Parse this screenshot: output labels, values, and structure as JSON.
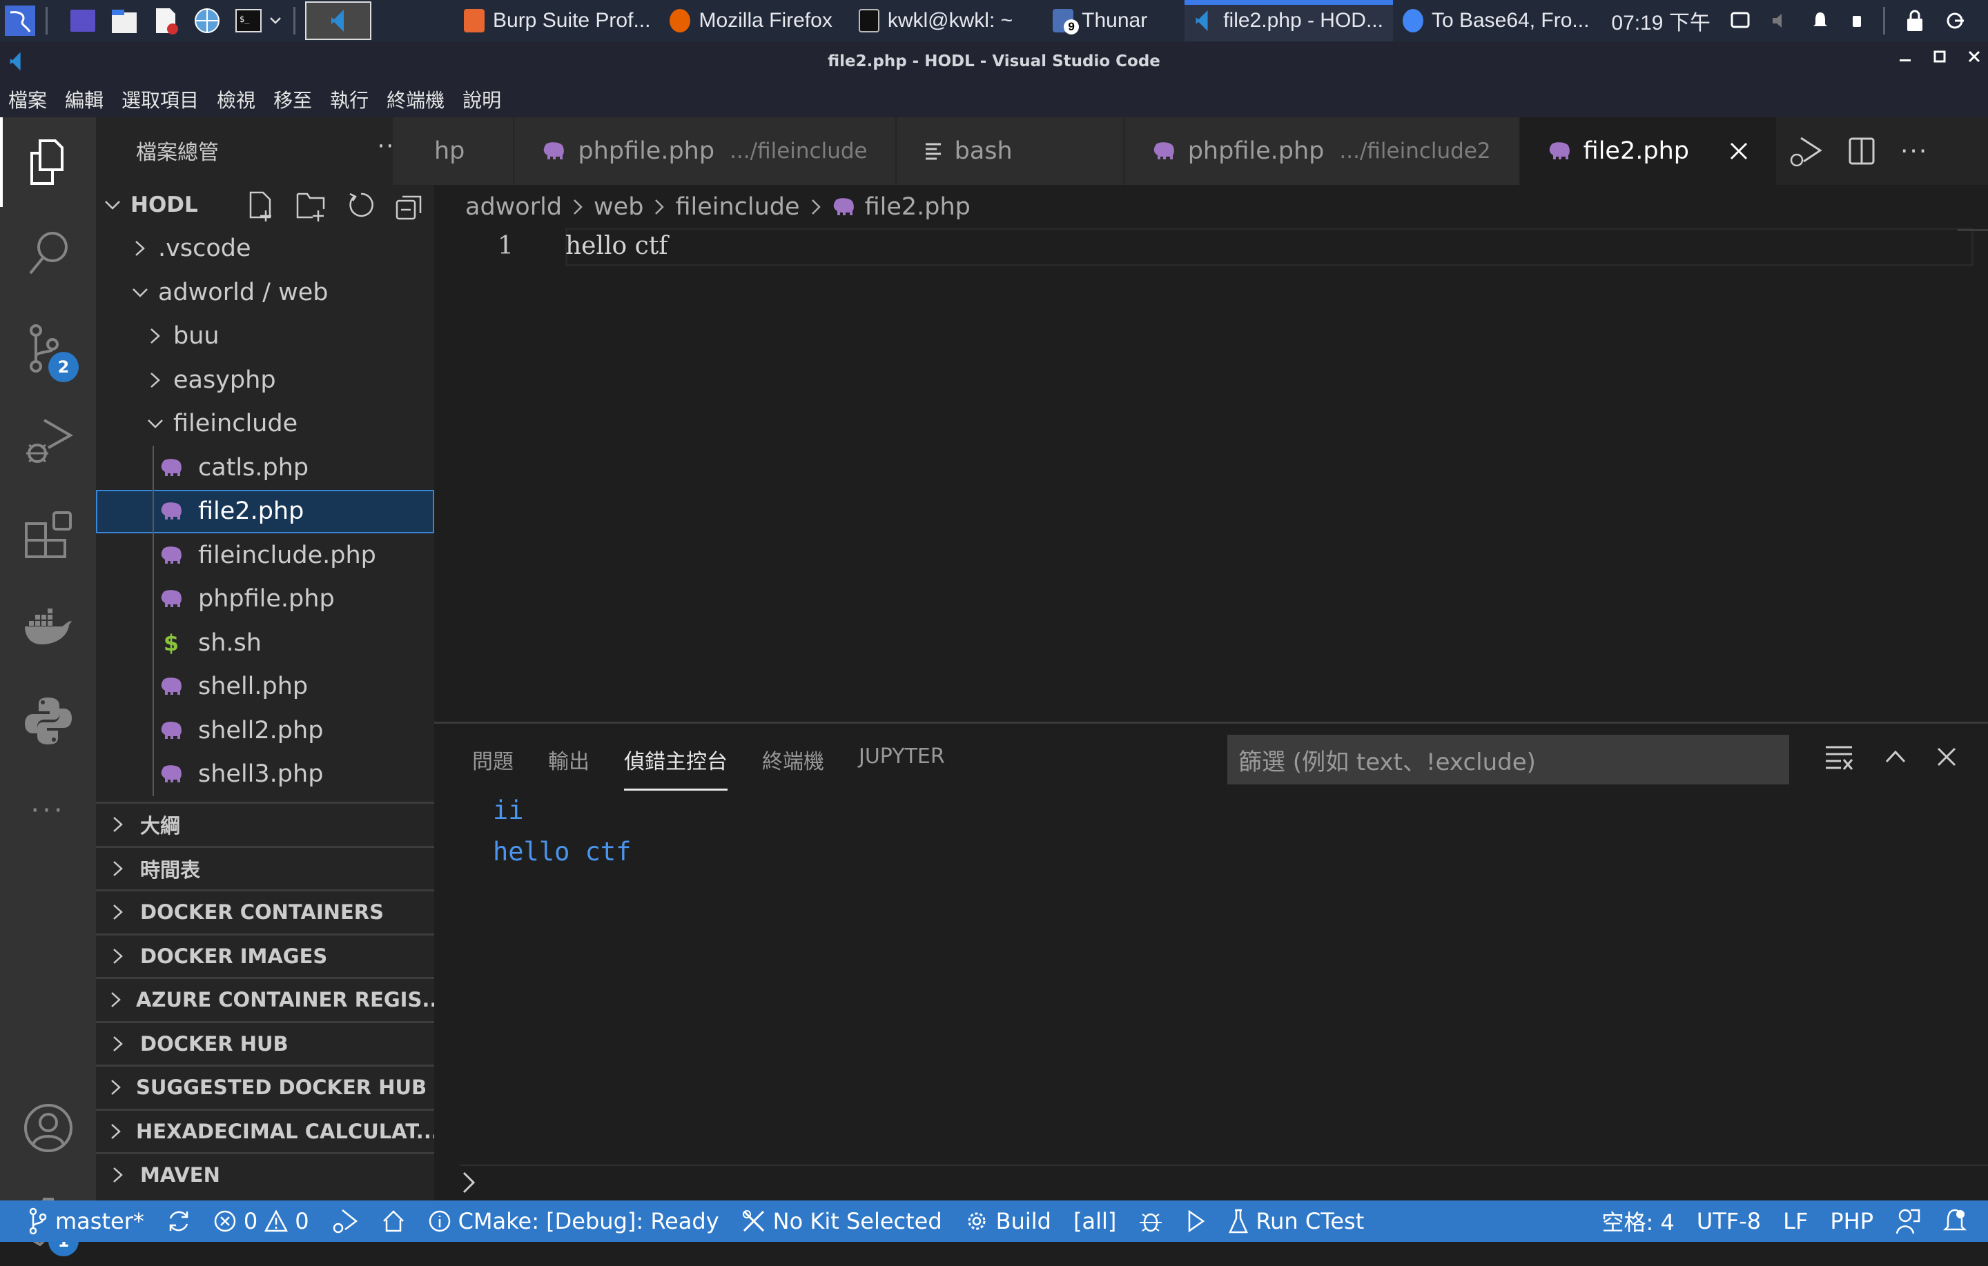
{
  "taskbar": {
    "apps": [
      {
        "label": "Burp Suite Prof...",
        "icon": "burp-icon",
        "color": "#e8662f"
      },
      {
        "label": "Mozilla Firefox",
        "icon": "firefox-icon",
        "color": "#e66000"
      },
      {
        "label": "kwkl@kwkl: ~",
        "icon": "terminal-icon",
        "color": "#111111"
      },
      {
        "label": "Thunar",
        "icon": "folder-icon",
        "color": "#4a6fb5",
        "badge": "9"
      },
      {
        "label": "file2.php - HOD...",
        "icon": "vscode-icon",
        "color": "#2a8ad4",
        "active": true
      },
      {
        "label": "To Base64, Fro...",
        "icon": "chrome-icon",
        "color": "#4285f4"
      }
    ],
    "clock": "07:19 下午"
  },
  "window": {
    "title": "file2.php - HODL - Visual Studio Code"
  },
  "menu": [
    "檔案",
    "編輯",
    "選取項目",
    "檢視",
    "移至",
    "執行",
    "終端機",
    "說明"
  ],
  "activity_bar": {
    "items": [
      {
        "name": "explorer",
        "active": true
      },
      {
        "name": "search"
      },
      {
        "name": "source-control",
        "badge": "2"
      },
      {
        "name": "run-debug"
      },
      {
        "name": "extensions"
      },
      {
        "name": "docker"
      },
      {
        "name": "python"
      },
      {
        "name": "more"
      }
    ],
    "bottom": [
      {
        "name": "accounts"
      },
      {
        "name": "manage",
        "badge": "1"
      }
    ]
  },
  "sidebar": {
    "title": "檔案總管",
    "more": "···",
    "root": "HODL",
    "tree": [
      {
        "label": ".vscode",
        "type": "folder",
        "expanded": false,
        "depth": 1
      },
      {
        "label": "adworld / web",
        "type": "folder",
        "expanded": true,
        "depth": 1
      },
      {
        "label": "buu",
        "type": "folder",
        "expanded": false,
        "depth": 2
      },
      {
        "label": "easyphp",
        "type": "folder",
        "expanded": false,
        "depth": 2
      },
      {
        "label": "fileinclude",
        "type": "folder",
        "expanded": true,
        "depth": 2
      },
      {
        "label": "catls.php",
        "type": "php",
        "depth": 3
      },
      {
        "label": "file2.php",
        "type": "php",
        "depth": 3,
        "selected": true
      },
      {
        "label": "fileinclude.php",
        "type": "php",
        "depth": 3
      },
      {
        "label": "phpfile.php",
        "type": "php",
        "depth": 3
      },
      {
        "label": "sh.sh",
        "type": "shell",
        "depth": 3
      },
      {
        "label": "shell.php",
        "type": "php",
        "depth": 3
      },
      {
        "label": "shell2.php",
        "type": "php",
        "depth": 3
      },
      {
        "label": "shell3.php",
        "type": "php",
        "depth": 3
      }
    ],
    "sections": [
      "大綱",
      "時間表",
      "DOCKER CONTAINERS",
      "DOCKER IMAGES",
      "AZURE CONTAINER REGIS...",
      "DOCKER HUB",
      "SUGGESTED DOCKER HUB ...",
      "HEXADECIMAL CALCULAT...",
      "MAVEN"
    ]
  },
  "tabs": [
    {
      "label": "hp",
      "desc": "",
      "icon": "php"
    },
    {
      "label": "phpfile.php",
      "desc": ".../fileinclude",
      "icon": "php"
    },
    {
      "label": "bash",
      "desc": "",
      "icon": "text"
    },
    {
      "label": "phpfile.php",
      "desc": ".../fileinclude2",
      "icon": "php"
    },
    {
      "label": "file2.php",
      "desc": "",
      "icon": "php",
      "active": true
    }
  ],
  "breadcrumb": [
    "adworld",
    "web",
    "fileinclude",
    "file2.php"
  ],
  "editor": {
    "lines": [
      {
        "number": "1",
        "text": "hello ctf"
      }
    ]
  },
  "panel": {
    "tabs": [
      "問題",
      "輸出",
      "偵錯主控台",
      "終端機",
      "JUPYTER"
    ],
    "active_tab": "偵錯主控台",
    "filter_placeholder": "篩選 (例如 text、!exclude)",
    "console_lines": [
      "ii",
      "hello ctf"
    ]
  },
  "statusbar": {
    "branch": "master*",
    "errors": "0",
    "warnings": "0",
    "cmake": "CMake: [Debug]: Ready",
    "kit": "No Kit Selected",
    "build": "Build",
    "target": "[all]",
    "ctest": "Run CTest",
    "spaces": "空格: 4",
    "encoding": "UTF-8",
    "eol": "LF",
    "language": "PHP"
  },
  "colors": {
    "accent": "#3079c9",
    "php_icon": "#a074c4",
    "shell_icon": "#89c43c",
    "console_text": "#4a95ee"
  }
}
